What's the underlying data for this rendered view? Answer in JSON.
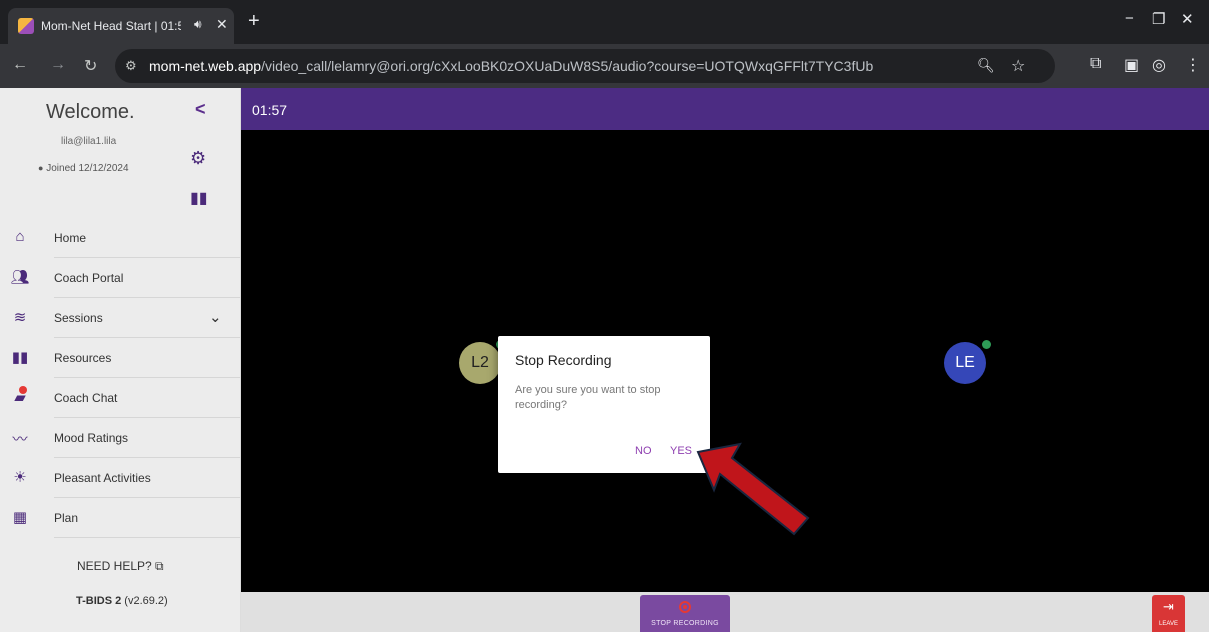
{
  "browser": {
    "tab_title": "Mom-Net Head Start | 01:5",
    "new_tab": "+",
    "url_host": "mom-net.web.app",
    "url_path": "/video_call/lelamry@ori.org/cXxLooBK0zOXUaDuW8S5/audio?course=UOTQWxqGFFlt7TYC3fUb"
  },
  "sidebar": {
    "welcome": "Welcome.",
    "email": "lila@lila1.lila",
    "joined": "Joined 12/12/2024",
    "items": [
      {
        "label": "Home",
        "icon": "home-icon"
      },
      {
        "label": "Coach Portal",
        "icon": "people-icon"
      },
      {
        "label": "Sessions",
        "icon": "layers-icon"
      },
      {
        "label": "Resources",
        "icon": "book-icon"
      },
      {
        "label": "Coach Chat",
        "icon": "chat-icon"
      },
      {
        "label": "Mood Ratings",
        "icon": "trend-icon"
      },
      {
        "label": "Pleasant Activities",
        "icon": "sun-icon"
      },
      {
        "label": "Plan",
        "icon": "calendar-icon"
      }
    ],
    "help": "NEED HELP?",
    "version_name": "T-BIDS 2",
    "version_num": "(v2.69.2)"
  },
  "call": {
    "timer": "01:57",
    "participant_1": "L2",
    "participant_2": "LE",
    "stop_recording": "STOP RECORDING",
    "leave": "LEAVE"
  },
  "dialog": {
    "title": "Stop Recording",
    "body": "Are you sure you want to stop recording?",
    "no": "NO",
    "yes": "YES"
  },
  "colors": {
    "brand_purple": "#4c2c83",
    "accent_purple": "#8e3fb0",
    "leave_red": "#d93636",
    "annotation_arrow": "#c0151b"
  }
}
